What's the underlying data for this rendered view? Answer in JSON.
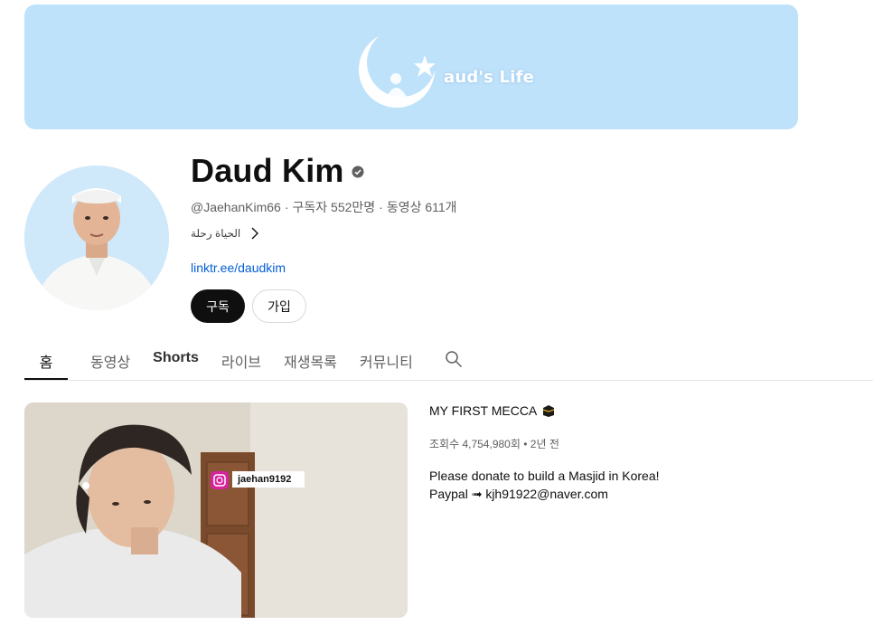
{
  "banner": {
    "brand_text": "aud's Life"
  },
  "channel": {
    "name": "Daud Kim",
    "handle": "@JaehanKim66",
    "subscribers": "구독자 552만명",
    "videos": "동영상 611개",
    "separator": "·",
    "description": "الحياة رحلة",
    "link": "linktr.ee/daudkim"
  },
  "buttons": {
    "subscribe": "구독",
    "join": "가입"
  },
  "tabs": [
    {
      "label": "홈",
      "active": true
    },
    {
      "label": "동영상",
      "active": false
    },
    {
      "label": "Shorts",
      "active": false
    },
    {
      "label": "라이브",
      "active": false
    },
    {
      "label": "재생목록",
      "active": false
    },
    {
      "label": "커뮤니티",
      "active": false
    }
  ],
  "featured_video": {
    "title": "MY FIRST MECCA",
    "title_emoji": "kaaba-icon",
    "views": "조회수 4,754,980회",
    "age": "2년 전",
    "meta_separator": "•",
    "description_line1": "Please donate to build a Masjid in Korea!",
    "description_line2": "Paypal ➟ kjh91922@naver.com",
    "overlay_handle": "jaehan9192"
  },
  "colors": {
    "banner_bg": "#bfe2fb",
    "link": "#065fd4",
    "subscribe_bg": "#0f0f0f"
  }
}
